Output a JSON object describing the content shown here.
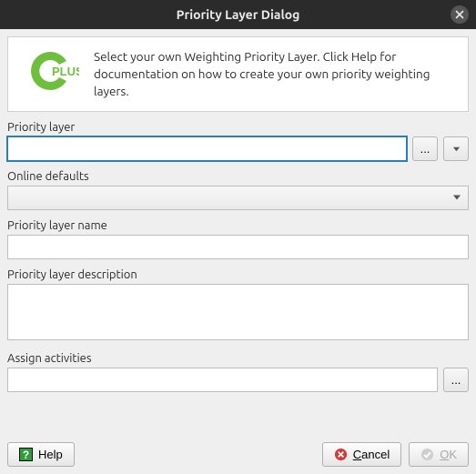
{
  "titlebar": {
    "title": "Priority Layer Dialog"
  },
  "intro": {
    "logo_text": "PLUS",
    "text": "Select your own Weighting Priority Layer. Click Help for documentation on how to create your own priority weighting layers."
  },
  "fields": {
    "priority_layer": {
      "label": "Priority layer",
      "value": "",
      "browse": "...",
      "dropdown": ""
    },
    "online_defaults": {
      "label": "Online defaults",
      "value": ""
    },
    "priority_layer_name": {
      "label": "Priority layer name",
      "value": ""
    },
    "priority_layer_description": {
      "label": "Priority layer description",
      "value": ""
    },
    "assign_activities": {
      "label": "Assign activities",
      "value": "",
      "browse": "..."
    }
  },
  "footer": {
    "help": "Help",
    "cancel": "Cancel",
    "ok": "OK"
  }
}
